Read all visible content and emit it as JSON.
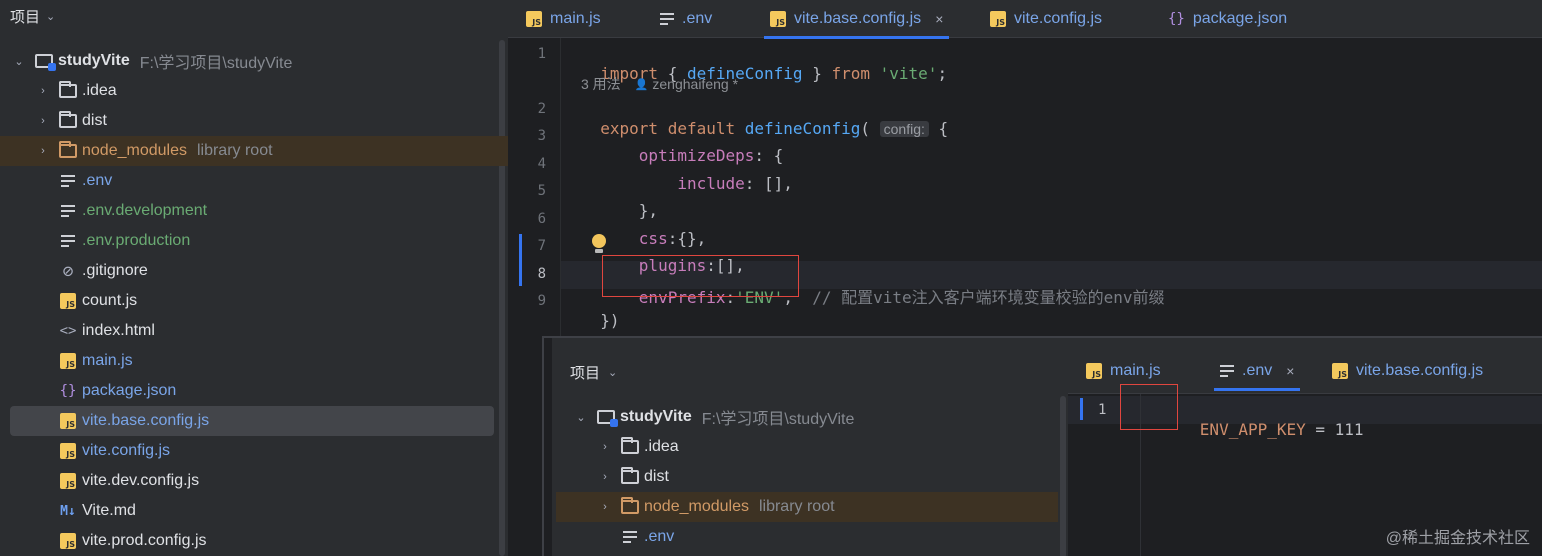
{
  "left_panel": {
    "header_label": "项目",
    "tree": [
      {
        "label": "studyVite",
        "hint": "F:\\学习项目\\studyVite",
        "icon": "project-folder-icon",
        "expanded": true
      },
      {
        "label": ".idea",
        "icon": "folder-icon"
      },
      {
        "label": "dist",
        "icon": "folder-icon"
      },
      {
        "label": "node_modules",
        "hint": "library root",
        "icon": "folder-icon"
      },
      {
        "label": ".env",
        "icon": "text-file-icon"
      },
      {
        "label": ".env.development",
        "icon": "text-file-icon"
      },
      {
        "label": ".env.production",
        "icon": "text-file-icon"
      },
      {
        "label": ".gitignore",
        "icon": "ignore-file-icon"
      },
      {
        "label": "count.js",
        "icon": "js-file-icon"
      },
      {
        "label": "index.html",
        "icon": "html-file-icon"
      },
      {
        "label": "main.js",
        "icon": "js-file-icon"
      },
      {
        "label": "package.json",
        "icon": "json-file-icon"
      },
      {
        "label": "vite.base.config.js",
        "icon": "js-file-icon",
        "selected": true
      },
      {
        "label": "vite.config.js",
        "icon": "js-file-icon"
      },
      {
        "label": "vite.dev.config.js",
        "icon": "js-file-icon"
      },
      {
        "label": "Vite.md",
        "icon": "markdown-file-icon"
      },
      {
        "label": "vite.prod.config.js",
        "icon": "js-file-icon"
      }
    ]
  },
  "editor": {
    "tabs": [
      {
        "label": "main.js",
        "icon": "js-file-icon"
      },
      {
        "label": ".env",
        "icon": "text-file-icon"
      },
      {
        "label": "vite.base.config.js",
        "icon": "js-file-icon",
        "active": true,
        "close": "×"
      },
      {
        "label": "vite.config.js",
        "icon": "js-file-icon"
      },
      {
        "label": "package.json",
        "icon": "json-file-icon"
      }
    ],
    "line_numbers": [
      "1",
      "2",
      "3",
      "4",
      "5",
      "6",
      "7",
      "8",
      "9"
    ],
    "usage_hint": "3 用法",
    "author_hint": "zenghaifeng *",
    "inlay_param": "config:",
    "code": {
      "l1_import": "import",
      "l1_open": " { ",
      "l1_fn": "defineConfig",
      "l1_close": " } ",
      "l1_from": "from",
      "l1_str": " 'vite'",
      "l1_end": ";",
      "l2_export": "export default",
      "l2_fn": " defineConfig",
      "l2_paren": "(",
      "l2_brace": " {",
      "l3_prop": "    optimizeDeps",
      "l3_rest": ": {",
      "l4_prop": "        include",
      "l4_rest": ": [],",
      "l5": "    },",
      "l6_prop": "    css",
      "l6_rest": ":{},",
      "l7_prop": "    plugins",
      "l7_rest": ":[],",
      "l8_prop": "    envPrefix",
      "l8_colon": ":",
      "l8_str": "'ENV'",
      "l8_comma": ",  ",
      "l8_comment": "// 配置vite注入客户端环境变量校验的env前缀",
      "l9": "})"
    }
  },
  "inset_window": {
    "header_label": "项目",
    "tree": [
      {
        "label": "studyVite",
        "hint": "F:\\学习项目\\studyVite",
        "icon": "project-folder-icon"
      },
      {
        "label": ".idea",
        "icon": "folder-icon"
      },
      {
        "label": "dist",
        "icon": "folder-icon"
      },
      {
        "label": "node_modules",
        "hint": "library root",
        "icon": "folder-icon"
      },
      {
        "label": ".env",
        "icon": "text-file-icon"
      }
    ],
    "tabs": [
      {
        "label": "main.js",
        "icon": "js-file-icon"
      },
      {
        "label": ".env",
        "icon": "text-file-icon",
        "active": true,
        "close": "×"
      },
      {
        "label": "vite.base.config.js",
        "icon": "js-file-icon"
      }
    ],
    "line_number": "1",
    "code_key": "ENV_APP_KEY",
    "code_rest": " = 111"
  },
  "watermark": "@稀土掘金技术社区",
  "colors": {
    "accent": "#3574f0",
    "highlight_box": "#e0463f",
    "library_folder": "#d19a66",
    "modified_file": "#6aab73"
  }
}
